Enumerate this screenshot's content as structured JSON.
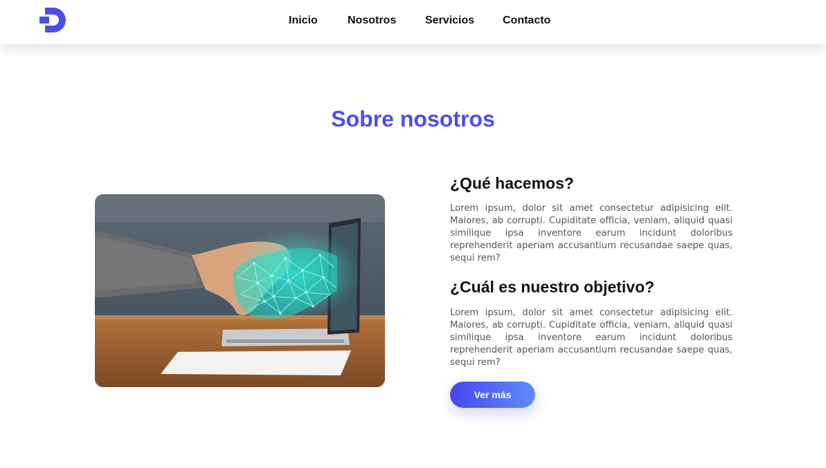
{
  "colors": {
    "accent": "#4a4ef0",
    "button_gradient_start": "#4747f0",
    "button_gradient_end": "#5f8cf7",
    "heading_text": "#111111",
    "body_text": "#555555",
    "page_background": "#ffffff"
  },
  "header": {
    "logo_icon": "brand-d-logo-icon",
    "nav": [
      {
        "label": "Inicio"
      },
      {
        "label": "Nosotros"
      },
      {
        "label": "Servicios"
      },
      {
        "label": "Contacto"
      }
    ]
  },
  "about": {
    "title": "Sobre nosotros",
    "image_icon": "handshake-with-digital-hand-photo",
    "blocks": [
      {
        "heading": "¿Qué hacemos?",
        "text": "Lorem ipsum, dolor sit amet consectetur adipisicing elit. Maiores, ab corrupti. Cupiditate officia, veniam, aliquid quasi similique ipsa inventore earum incidunt doloribus reprehenderit aperiam accusantium recusandae saepe quas, sequi rem?"
      },
      {
        "heading": "¿Cuál es nuestro objetivo?",
        "text": "Lorem ipsum, dolor sit amet consectetur adipisicing elit. Maiores, ab corrupti. Cupiditate officia, veniam, aliquid quasi similique ipsa inventore earum incidunt doloribus reprehenderit aperiam accusantium recusandae saepe quas, sequi rem?"
      }
    ],
    "button_label": "Ver más"
  }
}
